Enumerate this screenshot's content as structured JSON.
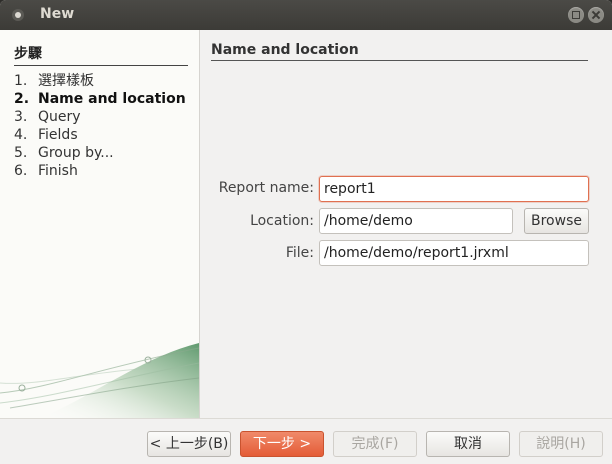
{
  "window": {
    "title": "New"
  },
  "sidebar": {
    "title": "步驟",
    "steps": [
      {
        "num": "1.",
        "label": "選擇樣板"
      },
      {
        "num": "2.",
        "label": "Name and location"
      },
      {
        "num": "3.",
        "label": "Query"
      },
      {
        "num": "4.",
        "label": "Fields"
      },
      {
        "num": "5.",
        "label": "Group by..."
      },
      {
        "num": "6.",
        "label": "Finish"
      }
    ],
    "active_step": 2
  },
  "main": {
    "title": "Name and location",
    "report_name": {
      "label": "Report name:",
      "value": "report1"
    },
    "location": {
      "label": "Location:",
      "value": "/home/demo",
      "browse_label": "Browse"
    },
    "file": {
      "label": "File:",
      "value": "/home/demo/report1.jrxml"
    }
  },
  "footer": {
    "back": "< 上一步(B)",
    "next": "下一步 >",
    "finish": "完成(F)",
    "cancel": "取消",
    "help": "說明(H)"
  },
  "colors": {
    "accent": "#e45c37",
    "focus_border": "#e07050",
    "titlebar": "#3c3b37"
  },
  "icons": [
    "window-menu-icon",
    "maximize-icon",
    "close-icon"
  ]
}
